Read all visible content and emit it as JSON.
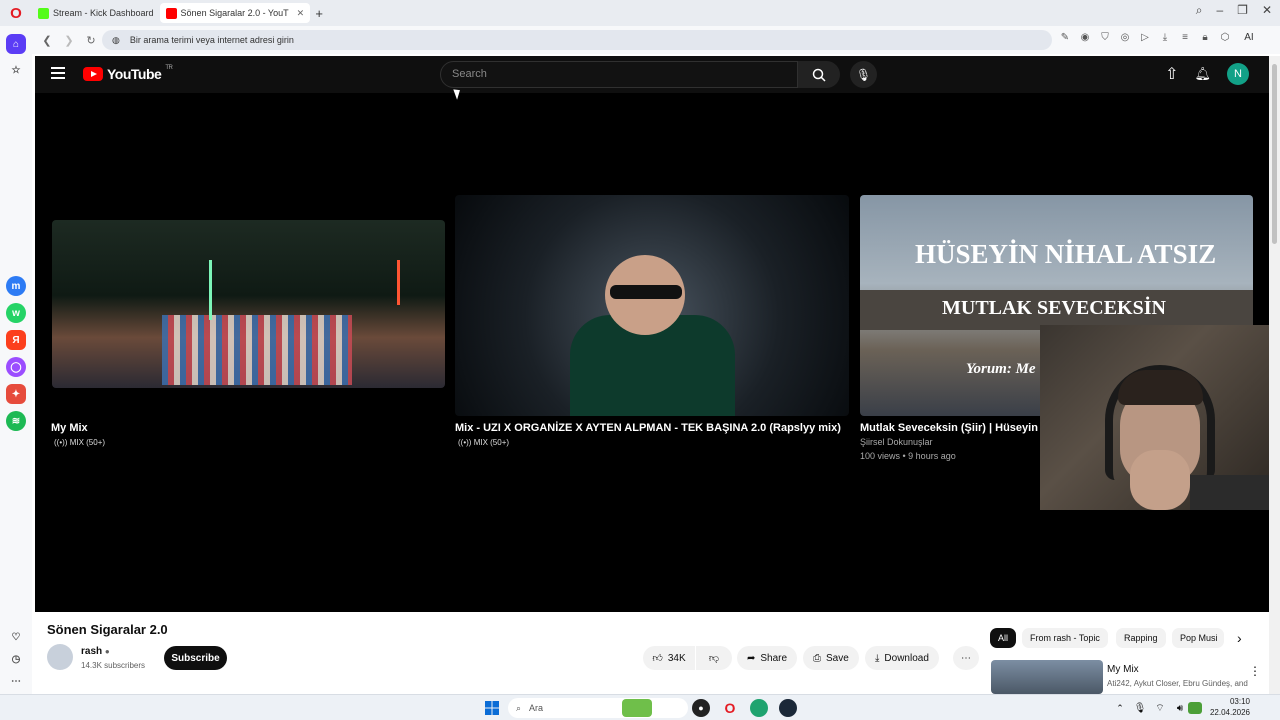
{
  "browser": {
    "tabs": [
      {
        "label": "Stream - Kick Dashboard",
        "favicon_color": "#53fc18"
      },
      {
        "label": "Sönen Sigaralar 2.0 - YouT",
        "favicon_color": "#ff0000"
      }
    ],
    "url_placeholder": "Bir arama terimi veya internet adresi girin",
    "ai_label": "AI"
  },
  "youtube": {
    "logo_text": "YouTube",
    "region": "TR",
    "search_placeholder": "Search",
    "avatar_letter": "N",
    "cards": [
      {
        "title": "My Mix",
        "meta": "MIX (50+)"
      },
      {
        "title": "Mix - UZI X ORGANİZE X AYTEN ALPMAN - TEK BAŞINA 2.0 (Rapslyy mix)",
        "meta": "MIX (50+)"
      },
      {
        "title": "Mutlak Seveceksin (Şiir) | Hüseyin Ni",
        "channel": "Şiirsel Dokunuşlar",
        "stats": "100 views • 9 hours ago",
        "thumb_line1": "HÜSEYİN NİHAL ATSIZ",
        "thumb_line2": "MUTLAK SEVECEKSİN",
        "thumb_line3": "Yorum: Me"
      }
    ],
    "video": {
      "title": "Sönen Sigaralar 2.0",
      "channel": "rash",
      "subscribers": "14.3K subscribers",
      "subscribe_label": "Subscribe",
      "likes": "34K",
      "share_label": "Share",
      "save_label": "Save",
      "download_label": "Download"
    },
    "chips": [
      "All",
      "From rash - Topic",
      "Rapping",
      "Pop Musi"
    ],
    "suggestion": {
      "title": "My Mix",
      "meta": "Ati242, Aykut Closer, Ebru Gündeş, and"
    }
  },
  "taskbar": {
    "search_label": "Ara",
    "time": "03:10",
    "date": "22.04.2026"
  }
}
